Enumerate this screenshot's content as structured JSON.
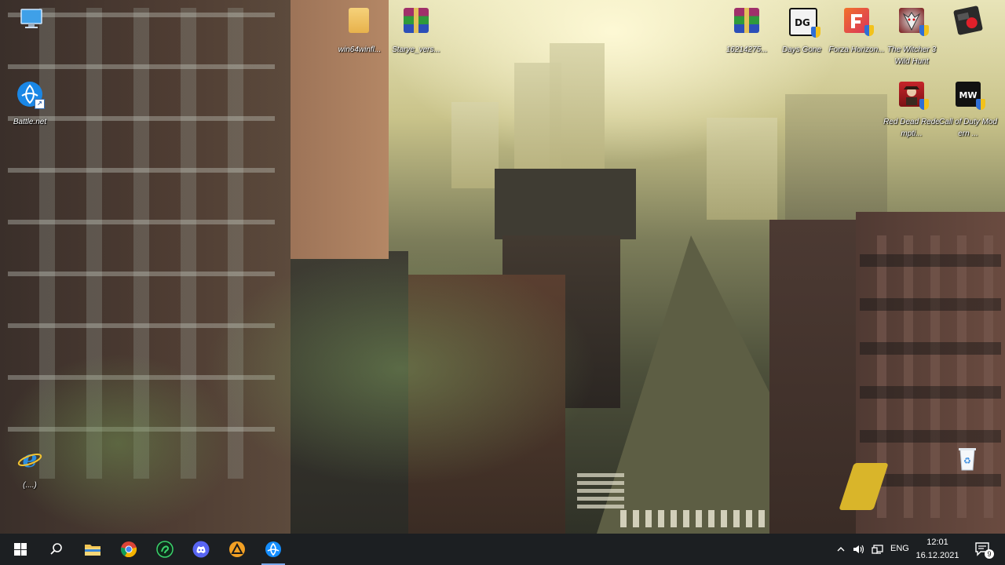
{
  "desktop": {
    "icons": [
      {
        "label": "",
        "name": "this-pc-icon"
      },
      {
        "label": "Battle.net",
        "name": "battlenet-icon"
      },
      {
        "label": "(....)",
        "name": "internet-explorer-icon"
      },
      {
        "label": "win64winfl...",
        "name": "folder-icon"
      },
      {
        "label": "Starye_vers...",
        "name": "winrar-archive-icon"
      },
      {
        "label": "16214275...",
        "name": "winrar-archive-icon"
      },
      {
        "label": "Days Gone",
        "name": "days-gone-icon"
      },
      {
        "label": "Forza Horizon...",
        "name": "forza-horizon-icon"
      },
      {
        "label": "The Witcher 3 Wild Hunt",
        "name": "witcher-icon"
      },
      {
        "label": "",
        "name": "music-app-icon"
      },
      {
        "label": "Red Dead Redempti...",
        "name": "red-dead-icon"
      },
      {
        "label": "Call of Duty Modern ...",
        "name": "call-of-duty-icon"
      },
      {
        "label": "",
        "name": "recycle-bin-icon"
      }
    ]
  },
  "taskbar": {
    "apps": [
      "start",
      "search",
      "file-explorer",
      "chrome",
      "razer",
      "discord",
      "ea-origin",
      "battlenet"
    ],
    "tray": {
      "language": "ENG",
      "time": "12:01",
      "date": "16.12.2021",
      "notification_count": "9"
    }
  },
  "colors": {
    "taskbar": "#1c1f22",
    "accent": "#78a7e8"
  }
}
